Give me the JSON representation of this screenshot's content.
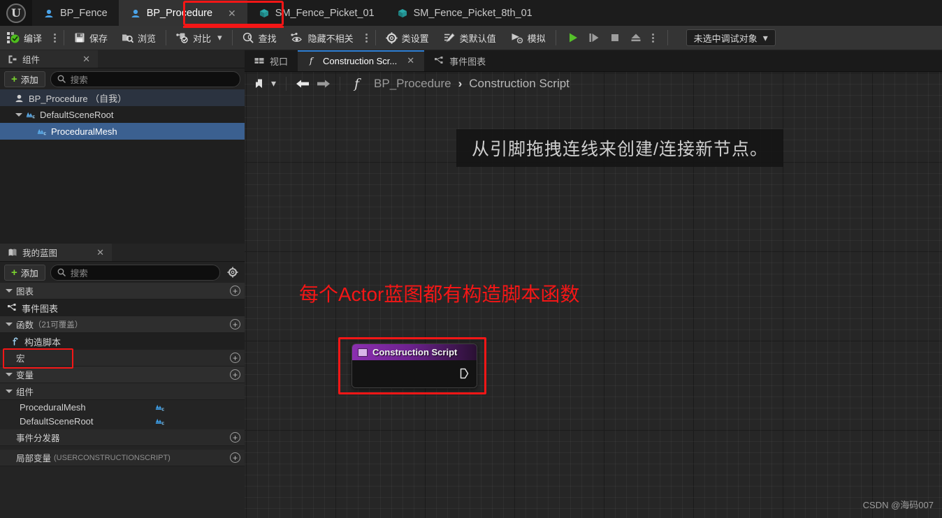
{
  "window": {
    "logo_glyph": "U"
  },
  "tabbar": {
    "tabs": [
      {
        "label": "BP_Fence",
        "icon": "blueprint-actor-icon",
        "active": false,
        "closable": false
      },
      {
        "label": "BP_Procedure",
        "icon": "blueprint-actor-icon",
        "active": true,
        "closable": true,
        "close_label": "✕"
      },
      {
        "label": "SM_Fence_Picket_01",
        "icon": "static-mesh-icon",
        "active": false,
        "closable": false
      },
      {
        "label": "SM_Fence_Picket_8th_01",
        "icon": "static-mesh-icon",
        "active": false,
        "closable": false
      }
    ]
  },
  "toolbar": {
    "items": [
      {
        "label": "编译",
        "icon": "compile-icon",
        "kebab": true
      },
      {
        "label": "保存",
        "icon": "save-icon",
        "kebab": false
      },
      {
        "label": "浏览",
        "icon": "browse-icon",
        "kebab": false
      },
      {
        "label": "对比",
        "icon": "diff-icon",
        "kebab": false,
        "dropdown": true
      },
      {
        "label": "查找",
        "icon": "find-icon",
        "kebab": false
      },
      {
        "label": "隐藏不相关",
        "icon": "hide-unrelated-icon",
        "kebab": true
      },
      {
        "label": "类设置",
        "icon": "class-settings-icon",
        "kebab": false
      },
      {
        "label": "类默认值",
        "icon": "class-defaults-icon",
        "kebab": false
      },
      {
        "label": "模拟",
        "icon": "simulate-icon",
        "kebab": false
      }
    ],
    "transport": [
      {
        "name": "play-icon",
        "glyph": "▶"
      },
      {
        "name": "step-icon",
        "glyph": "▷"
      },
      {
        "name": "stop-icon",
        "glyph": "■"
      },
      {
        "name": "eject-icon",
        "glyph": "⏏"
      }
    ],
    "debug_object": {
      "label": "未选中调试对象",
      "chevron": "⌄"
    }
  },
  "components_panel": {
    "tab_label": "组件",
    "tab_icon": "components-icon",
    "close_label": "✕",
    "add_label": "添加",
    "search_placeholder": "搜索",
    "search_value": "",
    "tree": [
      {
        "label": "BP_Procedure （自我）",
        "icon": "blueprint-actor-icon",
        "indent": 0,
        "state": "root",
        "twirl": "none"
      },
      {
        "label": "DefaultSceneRoot",
        "icon": "scene-component-icon",
        "indent": 1,
        "state": "normal",
        "twirl": "down"
      },
      {
        "label": "ProceduralMesh",
        "icon": "scene-component-icon",
        "indent": 2,
        "state": "selected",
        "twirl": "none"
      }
    ]
  },
  "myblueprint_panel": {
    "tab_label": "我的蓝图",
    "tab_icon": "blueprint-book-icon",
    "close_label": "✕",
    "add_label": "添加",
    "search_placeholder": "搜索",
    "search_value": "",
    "settings_icon": "gear-icon",
    "sections": [
      {
        "title": "图表",
        "suffix": "",
        "twirl": "down",
        "has_add": true,
        "items": [
          {
            "label": "事件图表",
            "icon": "event-graph-icon",
            "highlighted": false,
            "right_icon": ""
          }
        ]
      },
      {
        "title": "函数",
        "suffix": "（21可覆盖）",
        "twirl": "down",
        "has_add": true,
        "items": [
          {
            "label": "构造脚本",
            "icon": "function-icon",
            "highlighted": true,
            "right_icon": ""
          }
        ]
      },
      {
        "title": "宏",
        "suffix": "",
        "twirl": "none",
        "has_add": true,
        "items": []
      },
      {
        "title": "变量",
        "suffix": "",
        "twirl": "down",
        "has_add": true,
        "items": []
      }
    ],
    "components_group": {
      "title": "组件",
      "twirl": "down",
      "items": [
        {
          "label": "ProceduralMesh",
          "right_icon": "scene-component-icon"
        },
        {
          "label": "DefaultSceneRoot",
          "right_icon": "scene-component-icon"
        }
      ]
    },
    "footer_sections": [
      {
        "title": "事件分发器",
        "suffix": "",
        "has_add": true
      },
      {
        "title": "局部变量",
        "suffix": "(USERCONSTRUCTIONSCRIPT)",
        "has_add": true
      }
    ]
  },
  "graph_panel": {
    "tabs": [
      {
        "label": "视口",
        "icon": "viewport-icon",
        "active": false,
        "closable": false
      },
      {
        "label": "Construction Scr...",
        "icon": "function-icon",
        "active": true,
        "closable": true,
        "close_label": "✕"
      },
      {
        "label": "事件图表",
        "icon": "event-graph-icon",
        "active": false,
        "closable": false
      }
    ],
    "breadcrumb": {
      "bookmark_icon": "bookmark-icon",
      "bookmark_chevron": "⌄",
      "back_icon": "arrow-left-icon",
      "forward_icon": "arrow-right-icon",
      "function_icon": "function-icon",
      "parent": "BP_Procedure",
      "separator": "›",
      "current": "Construction Script"
    },
    "hint_banner": "从引脚拖拽连线来创建/连接新节点。",
    "annotation": "每个Actor蓝图都有构造脚本函数",
    "node": {
      "title": "Construction Script",
      "icon": "function-entry-icon",
      "exec_pin": "exec-output-pin"
    }
  },
  "watermark": "CSDN @海码007",
  "colors": {
    "accent_red": "#f41616",
    "selection_blue": "#3b6090",
    "tab_underline_blue": "#2e7fd4",
    "node_purple": "#8b2fb0",
    "add_green": "#7ad32f",
    "play_green": "#55c02a"
  }
}
